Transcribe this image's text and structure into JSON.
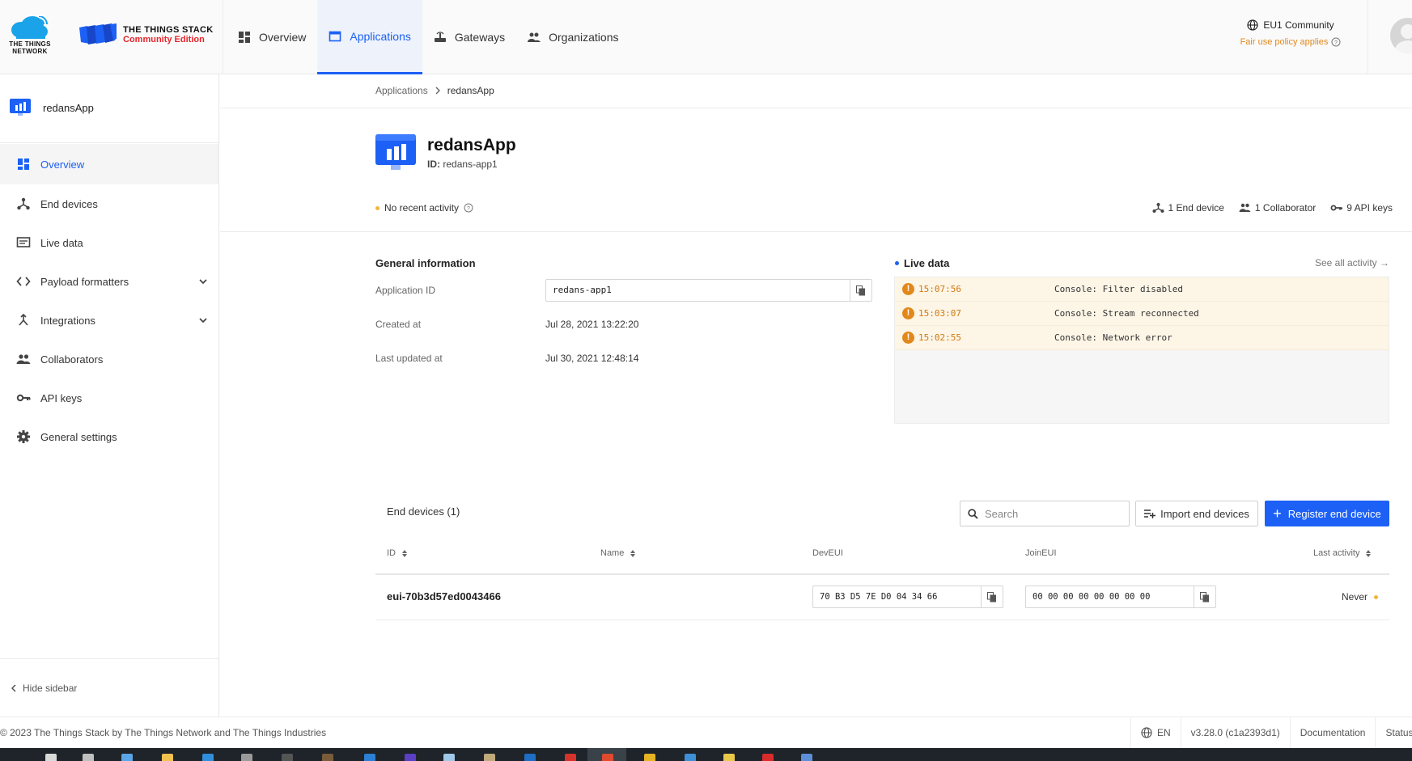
{
  "brand": {
    "ttn_logo_text": "THE THINGS NETWORK",
    "stack_line1": "THE THINGS STACK",
    "stack_line2": "Community Edition"
  },
  "nav": {
    "overview": "Overview",
    "applications": "Applications",
    "gateways": "Gateways",
    "organizations": "Organizations"
  },
  "network": {
    "cluster": "EU1 Community",
    "policy": "Fair use policy applies"
  },
  "sidebar": {
    "app_name": "redansApp",
    "items": [
      {
        "label": "Overview",
        "icon": "dashboard-icon",
        "active": true
      },
      {
        "label": "End devices",
        "icon": "devices-hub-icon"
      },
      {
        "label": "Live data",
        "icon": "live-data-icon"
      },
      {
        "label": "Payload formatters",
        "icon": "code-icon",
        "expandable": true
      },
      {
        "label": "Integrations",
        "icon": "merge-icon",
        "expandable": true
      },
      {
        "label": "Collaborators",
        "icon": "people-icon"
      },
      {
        "label": "API keys",
        "icon": "key-icon"
      },
      {
        "label": "General settings",
        "icon": "gear-icon"
      }
    ],
    "hide_label": "Hide sidebar"
  },
  "breadcrumb": {
    "parent": "Applications",
    "current": "redansApp"
  },
  "app": {
    "title": "redansApp",
    "id_label": "ID:",
    "id_value": "redans-app1",
    "activity": "No recent activity",
    "stats": {
      "end_devices": "1 End device",
      "collaborators": "1 Collaborator",
      "api_keys": "9 API keys"
    }
  },
  "general": {
    "title": "General information",
    "app_id_label": "Application ID",
    "app_id_value": "redans-app1",
    "created_label": "Created at",
    "created_value": "Jul 28, 2021 13:22:20",
    "updated_label": "Last updated at",
    "updated_value": "Jul 30, 2021 12:48:14"
  },
  "live": {
    "title": "Live data",
    "see_all": "See all activity →",
    "events": [
      {
        "time": "15:07:56",
        "message": "Console: Filter disabled"
      },
      {
        "time": "15:03:07",
        "message": "Console: Stream reconnected"
      },
      {
        "time": "15:02:55",
        "message": "Console: Network error"
      }
    ]
  },
  "devices": {
    "title": "End devices (1)",
    "search_placeholder": "Search",
    "import_label": "Import end devices",
    "register_label": "Register end device",
    "columns": {
      "id": "ID",
      "name": "Name",
      "deveui": "DevEUI",
      "joineui": "JoinEUI",
      "last_activity": "Last activity"
    },
    "rows": [
      {
        "id": "eui-70b3d57ed0043466",
        "name": "",
        "deveui": "70 B3 D5 7E D0 04 34 66",
        "joineui": "00 00 00 00 00 00 00 00",
        "last_activity": "Never"
      }
    ]
  },
  "footer": {
    "copyright": "© 2023 The Things Stack by The Things Network and The Things Industries",
    "language": "EN",
    "version": "v3.28.0 (c1a2393d1)",
    "documentation": "Documentation",
    "status": "Status"
  },
  "colors": {
    "accent": "#1c60f5",
    "warning": "#e2881b",
    "brand_red": "#e4262b"
  }
}
